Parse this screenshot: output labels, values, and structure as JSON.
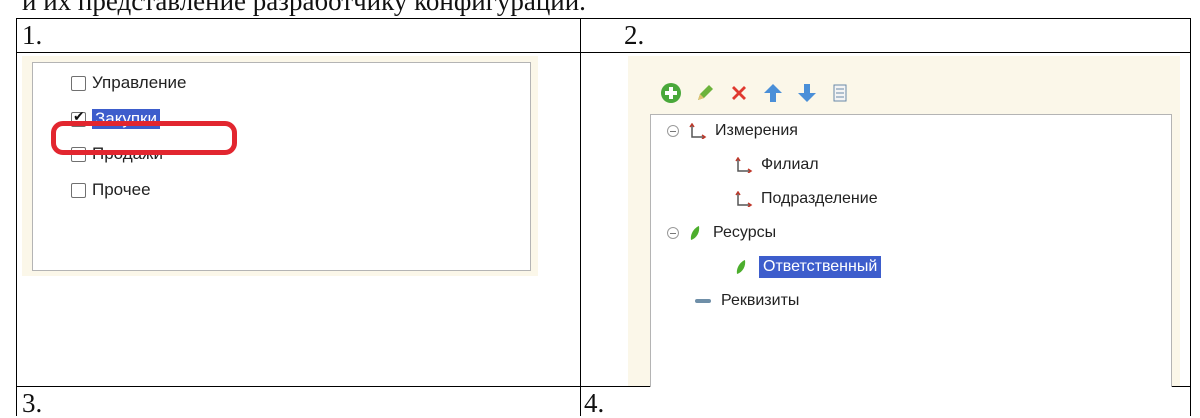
{
  "intro_text": "и их представление разработчику конфигурации.",
  "cells": {
    "one": "1.",
    "two": "2.",
    "three": "3.",
    "four": "4."
  },
  "panel1": {
    "items": [
      {
        "label": "Управление",
        "checked": false,
        "selected": false
      },
      {
        "label": "Закупки",
        "checked": true,
        "selected": true
      },
      {
        "label": "Продажи",
        "checked": false,
        "selected": false
      },
      {
        "label": "Прочее",
        "checked": false,
        "selected": false
      }
    ],
    "highlight_color": "#e2262f"
  },
  "panel2": {
    "toolbar": [
      "add-icon",
      "edit-icon",
      "delete-icon",
      "move-up-icon",
      "move-down-icon",
      "sort-icon"
    ],
    "tree": {
      "dimensions": "Измерения",
      "dim_items": [
        "Филиал",
        "Подразделение"
      ],
      "resources": "Ресурсы",
      "resource_items": [
        "Ответственный"
      ],
      "attributes": "Реквизиты"
    },
    "selection_color": "#3d5dcc"
  }
}
